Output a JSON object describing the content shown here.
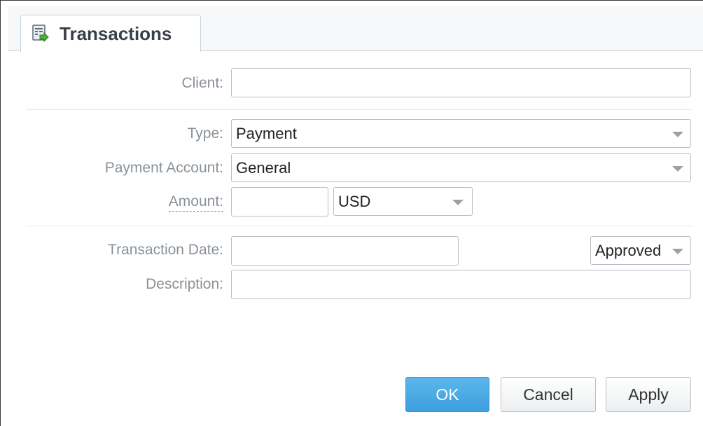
{
  "tab": {
    "title": "Transactions",
    "icon": "transactions-icon"
  },
  "form": {
    "client": {
      "label": "Client:",
      "value": ""
    },
    "type": {
      "label": "Type:",
      "value": "Payment"
    },
    "payment_account": {
      "label": "Payment Account:",
      "value": "General"
    },
    "amount": {
      "label": "Amount:",
      "value": "",
      "currency": "USD"
    },
    "transaction_date": {
      "label": "Transaction Date:",
      "value": "",
      "status": "Approved"
    },
    "description": {
      "label": "Description:",
      "value": ""
    }
  },
  "buttons": {
    "ok": "OK",
    "cancel": "Cancel",
    "apply": "Apply"
  },
  "colors": {
    "accent": "#3d9fde",
    "label": "#8a9299",
    "border": "#b7bec5"
  }
}
